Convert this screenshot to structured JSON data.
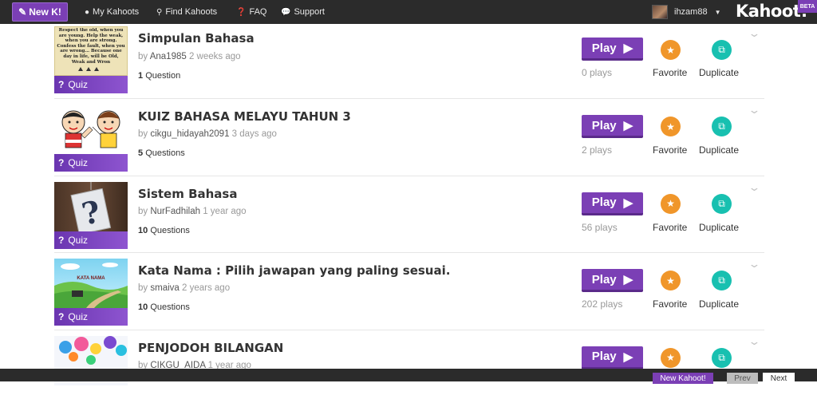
{
  "nav": {
    "new_label": "New K!",
    "links": [
      {
        "label": "My Kahoots",
        "icon": "user-icon"
      },
      {
        "label": "Find Kahoots",
        "icon": "search-icon"
      },
      {
        "label": "FAQ",
        "icon": "question-circle-icon"
      },
      {
        "label": "Support",
        "icon": "chat-bubble-icon"
      }
    ],
    "username": "ihzam88",
    "logo": "Kahoot!",
    "beta": "BETA"
  },
  "kahoots": [
    {
      "title": "Simpulan Bahasa",
      "by": "by",
      "author": "Ana1985",
      "age": "2 weeks ago",
      "question_count": "1",
      "question_word": "Question",
      "quiz_label": "Quiz",
      "play_label": "Play",
      "plays": "0 plays",
      "favorite": "Favorite",
      "duplicate": "Duplicate",
      "thumb_text": "Respect the old, when you are young. Help the weak, when you are strong. Confess the fault, when you are wrong... Because one day in life, will be Old, Weak and Wron"
    },
    {
      "title": "KUIZ BAHASA MELAYU TAHUN 3",
      "by": "by",
      "author": "cikgu_hidayah2091",
      "age": "3 days ago",
      "question_count": "5",
      "question_word": "Questions",
      "quiz_label": "Quiz",
      "play_label": "Play",
      "plays": "2 plays",
      "favorite": "Favorite",
      "duplicate": "Duplicate"
    },
    {
      "title": "Sistem Bahasa",
      "by": "by",
      "author": "NurFadhilah",
      "age": "1 year ago",
      "question_count": "10",
      "question_word": "Questions",
      "quiz_label": "Quiz",
      "play_label": "Play",
      "plays": "56 plays",
      "favorite": "Favorite",
      "duplicate": "Duplicate"
    },
    {
      "title": "Kata Nama : Pilih jawapan yang paling sesuai.",
      "by": "by",
      "author": "smaiva",
      "age": "2 years ago",
      "question_count": "10",
      "question_word": "Questions",
      "quiz_label": "Quiz",
      "play_label": "Play",
      "plays": "202 plays",
      "favorite": "Favorite",
      "duplicate": "Duplicate",
      "thumb_text": "KATA NAMA"
    },
    {
      "title": "PENJODOH BILANGAN",
      "by": "by",
      "author": "CIKGU_AIDA",
      "age": "1 year ago",
      "play_label": "Play"
    }
  ],
  "footer": {
    "new_kahoot": "New Kahoot!",
    "prev": "Prev",
    "next": "Next"
  },
  "colors": {
    "primary_purple": "#7b3fb5",
    "favorite_orange": "#f0962a",
    "duplicate_teal": "#18c0b0",
    "topbar": "#2b2b2b"
  }
}
